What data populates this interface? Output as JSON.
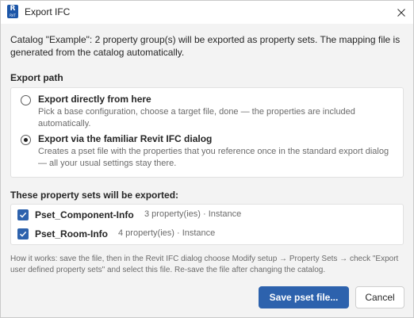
{
  "window": {
    "title": "Export IFC",
    "app_icon_letter": "R",
    "app_icon_sub": "RVT",
    "close_icon": "close-icon"
  },
  "intro_text": "Catalog \"Example\": 2 property group(s) will be exported as property sets. The mapping file is generated from the catalog automatically.",
  "export_path": {
    "label": "Export path",
    "options": [
      {
        "title": "Export directly from here",
        "description": "Pick a base configuration, choose a target file, done — the properties are included automatically.",
        "selected": false
      },
      {
        "title": "Export via the familiar Revit IFC dialog",
        "description": "Creates a pset file with the properties that you reference once in the standard export dialog — all your usual settings stay there.",
        "selected": true
      }
    ]
  },
  "property_sets": {
    "label": "These property sets will be exported:",
    "items": [
      {
        "name": "Pset_Component-Info",
        "meta": "3 property(ies) · Instance",
        "checked": true
      },
      {
        "name": "Pset_Room-Info",
        "meta": "4 property(ies) · Instance",
        "checked": true
      }
    ]
  },
  "howto_text": "How it works: save the file, then in the Revit IFC dialog choose Modify setup → Property Sets → check \"Export user defined property sets\" and select this file. Re-save the file after changing the catalog.",
  "buttons": {
    "save": "Save pset file...",
    "cancel": "Cancel"
  },
  "colors": {
    "accent": "#2d62ad",
    "background": "#f3f3f3",
    "panel": "#ffffff"
  }
}
